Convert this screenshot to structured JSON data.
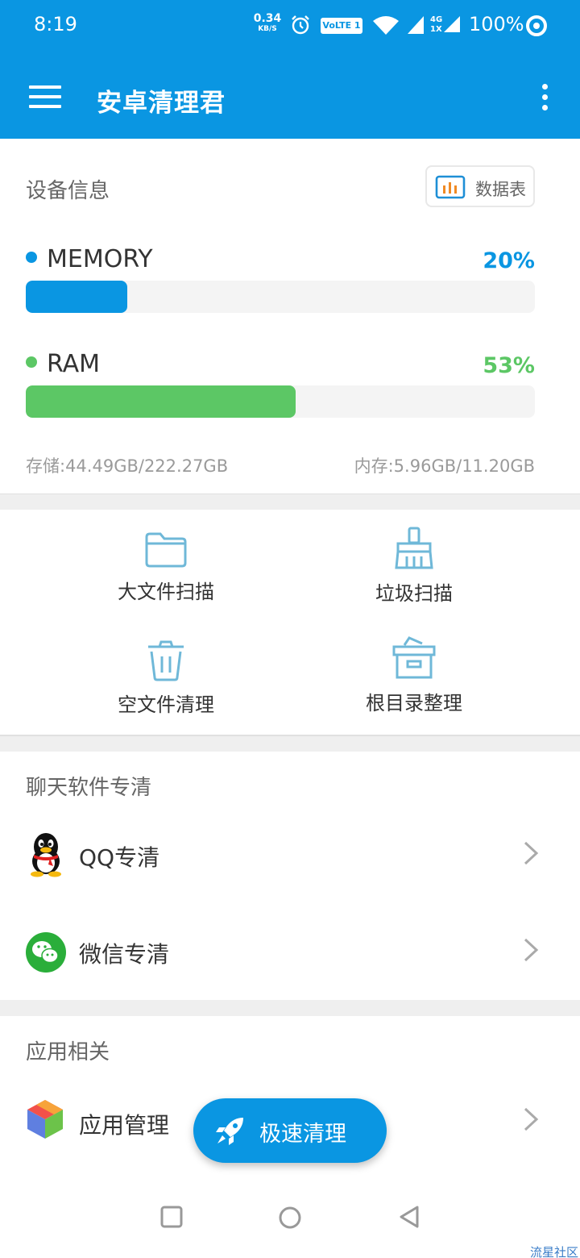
{
  "status_bar": {
    "time": "8:19",
    "speed_value": "0.34",
    "speed_unit": "KB/S",
    "volte": "VoLTE 1",
    "net_top": "4G",
    "net_bottom": "1X",
    "battery": "100%"
  },
  "app_bar": {
    "title": "安卓清理君"
  },
  "device_info": {
    "title": "设备信息",
    "datatable_label": "数据表",
    "meters": [
      {
        "label": "MEMORY",
        "percent_text": "20%",
        "fraction": 0.2,
        "color": "#0a96e2"
      },
      {
        "label": "RAM",
        "percent_text": "53%",
        "fraction": 0.53,
        "color": "#5cc765"
      }
    ],
    "storage": "存储:44.49GB/222.27GB",
    "memory": "内存:5.96GB/11.20GB"
  },
  "tools": [
    {
      "label": "大文件扫描",
      "icon": "folder-icon"
    },
    {
      "label": "垃圾扫描",
      "icon": "broom-icon"
    },
    {
      "label": "空文件清理",
      "icon": "trash-icon"
    },
    {
      "label": "根目录整理",
      "icon": "archive-box-icon"
    }
  ],
  "chat_section": {
    "title": "聊天软件专清",
    "items": [
      {
        "label": "QQ专清",
        "icon": "qq-penguin-icon"
      },
      {
        "label": "微信专清",
        "icon": "wechat-icon"
      }
    ]
  },
  "app_section": {
    "title": "应用相关",
    "items": [
      {
        "label": "应用管理",
        "icon": "app-cube-icon"
      }
    ]
  },
  "fab": {
    "label": "极速清理",
    "icon": "rocket-icon"
  },
  "watermark": "流星社区",
  "colors": {
    "accent": "#0a96e2",
    "green": "#5cc765",
    "icon_blue": "#6fb8d8"
  }
}
